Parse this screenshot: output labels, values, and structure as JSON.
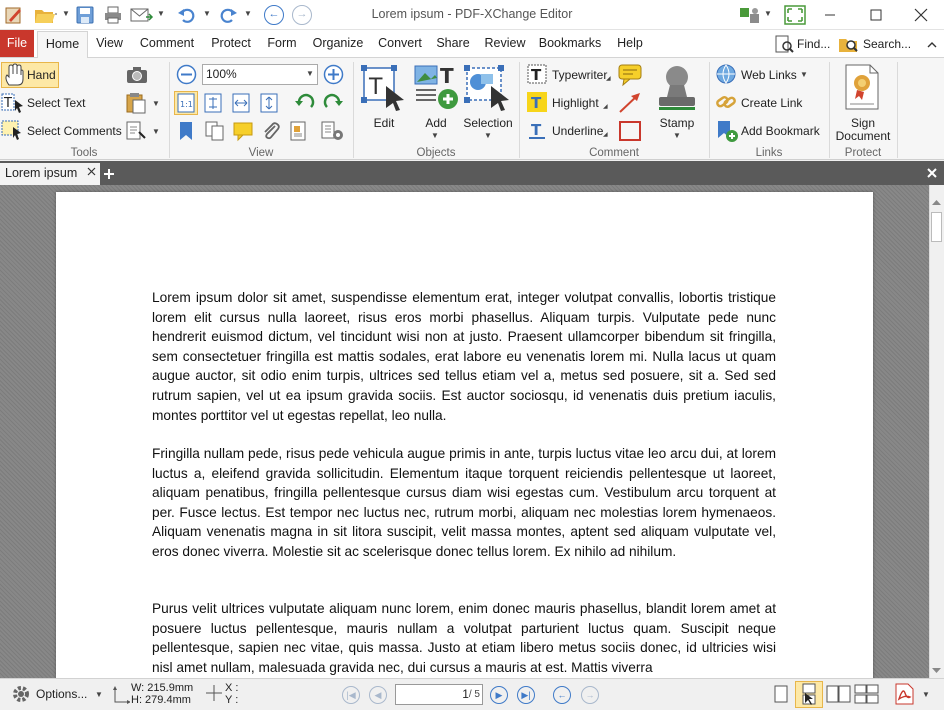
{
  "window": {
    "title": "Lorem ipsum - PDF-XChange Editor"
  },
  "menu": {
    "file": "File",
    "home": "Home",
    "items": [
      "View",
      "Comment",
      "Protect",
      "Form",
      "Organize",
      "Convert",
      "Share",
      "Review",
      "Bookmarks",
      "Help"
    ],
    "find": "Find...",
    "search": "Search..."
  },
  "ribbon": {
    "tools": {
      "hand": "Hand",
      "select_text": "Select Text",
      "select_comments": "Select Comments",
      "label": "Tools"
    },
    "view": {
      "zoom": "100%",
      "label": "View"
    },
    "objects": {
      "edit": "Edit",
      "add": "Add",
      "selection": "Selection",
      "label": "Objects"
    },
    "comment": {
      "typewriter": "Typewriter",
      "highlight": "Highlight",
      "underline": "Underline",
      "stamp": "Stamp",
      "label": "Comment"
    },
    "links": {
      "web_links": "Web Links",
      "create_link": "Create Link",
      "add_bookmark": "Add Bookmark",
      "label": "Links"
    },
    "protect": {
      "sign_line1": "Sign",
      "sign_line2": "Document",
      "label": "Protect"
    }
  },
  "tab": {
    "name": "Lorem ipsum"
  },
  "document": {
    "paragraphs": [
      "Lorem ipsum dolor sit amet, suspendisse elementum erat, integer volutpat convallis, lobortis tristique lorem elit cursus nulla laoreet, risus eros morbi phasellus. Aliquam turpis. Vulputate pede nunc hendrerit euismod dictum, vel tincidunt wisi non at justo. Praesent ullamcorper bibendum sit fringilla, sem consectetuer fringilla est mattis sodales, erat labore eu venenatis lorem mi. Nulla lacus ut quam augue auctor, sit odio enim turpis, ultrices sed tellus etiam vel a, metus sed posuere, sit a. Sed sed rutrum sapien, vel ut ea ipsum gravida sociis. Est auctor sociosqu, id venenatis duis pretium iaculis, montes porttitor vel ut egestas repellat, leo nulla.",
      "Fringilla nullam pede, risus pede vehicula augue primis in ante, turpis luctus vitae leo arcu dui, at lorem luctus a, eleifend gravida sollicitudin. Elementum itaque torquent reiciendis pellentesque ut laoreet, aliquam penatibus, fringilla pellentesque cursus diam wisi egestas cum. Vestibulum arcu torquent at per. Fusce lectus. Est tempor nec luctus nec, rutrum morbi, aliquam nec molestias lorem hymenaeos. Aliquam venenatis magna in sit litora suscipit, velit massa montes, aptent sed aliquam vulputate vel, eros donec viverra. Molestie sit ac scelerisque donec tellus lorem. Ex nihilo ad nihilum.",
      "Purus velit ultrices vulputate aliquam nunc lorem, enim donec mauris phasellus, blandit lorem amet at posuere luctus pellentesque, mauris nullam a volutpat parturient luctus quam. Suscipit neque pellentesque, sapien nec vitae, quis massa. Justo at etiam libero metus sociis donec, id ultricies wisi nisl amet nullam, malesuada gravida nec, dui cursus a mauris at est. Mattis viverra"
    ]
  },
  "status": {
    "options": "Options...",
    "width": "W: 215.9mm",
    "height": "H: 279.4mm",
    "x": "X :",
    "y": "Y :",
    "current_page": "1",
    "page_count": "/ 5"
  },
  "colors": {
    "file_tab": "#c9372c",
    "accent_blue": "#3f7ac8",
    "hand_active": "#fde8a6"
  },
  "icons": [
    "app-logo-icon",
    "open-folder-icon",
    "save-icon",
    "print-icon",
    "email-icon",
    "undo-icon",
    "redo-icon",
    "back-icon",
    "forward-icon",
    "ui-options-icon",
    "fullscreen-icon",
    "minimize-icon",
    "maximize-icon",
    "close-icon",
    "hand-icon",
    "snapshot-icon",
    "clipboard-icon",
    "zoom-out-icon",
    "zoom-in-icon",
    "rotate-icon",
    "bookmark-icon",
    "attachment-icon",
    "typewriter-icon",
    "callout-icon",
    "arrow-icon",
    "rectangle-icon",
    "stamp-icon",
    "globe-icon",
    "link-icon",
    "add-bookmark-icon",
    "sign-document-icon",
    "settings-icon",
    "first-page-icon",
    "prev-page-icon",
    "next-page-icon",
    "last-page-icon",
    "page-layout-icon",
    "pdf-icon"
  ]
}
